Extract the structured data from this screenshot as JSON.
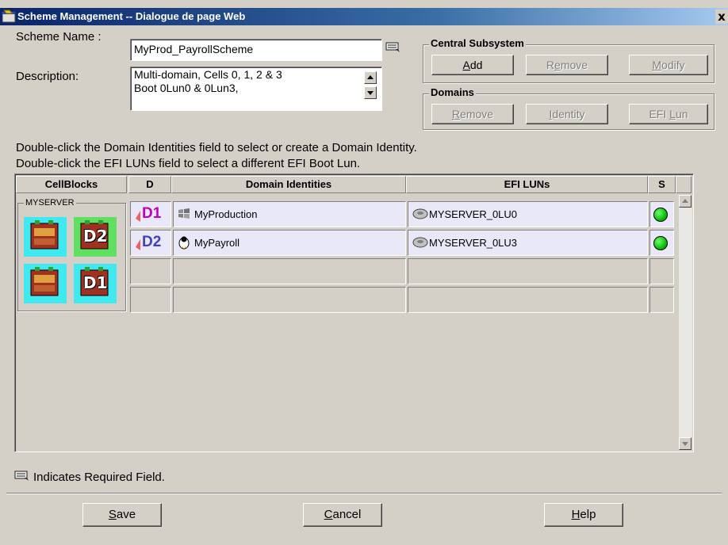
{
  "window": {
    "title": "Scheme Management -- Dialogue de page Web",
    "close": "x"
  },
  "form": {
    "scheme_name_label": "Scheme Name :",
    "scheme_name_value": "MyProd_PayrollScheme",
    "description_label": "Description:",
    "description_value": "Multi-domain, Cells 0, 1, 2 & 3\nBoot 0Lun0 & 0Lun3,"
  },
  "central_subsystem": {
    "title": "Central Subsystem",
    "add": "Add",
    "remove": "Remove",
    "modify": "Modify"
  },
  "domains": {
    "title": "Domains",
    "remove": "Remove",
    "identity": "Identity",
    "efi_lun": "EFI Lun"
  },
  "instructions": {
    "line1": "Double-click the Domain Identities field to select or create a Domain Identity.",
    "line2": "Double-click the EFI LUNs field to select a different EFI Boot Lun."
  },
  "table": {
    "headers": {
      "cellblocks": "CellBlocks",
      "d": "D",
      "identities": "Domain Identities",
      "efi": "EFI LUNs",
      "s": "S"
    },
    "server_name": "MYSERVER",
    "cellblock_labels": [
      "",
      "D2",
      "",
      "D1"
    ],
    "rows": [
      {
        "domain": "D1",
        "identity": "MyProduction",
        "identity_icon": "windows-icon",
        "efi_lun": "MYSERVER_0LU0",
        "status": "green"
      },
      {
        "domain": "D2",
        "identity": "MyPayroll",
        "identity_icon": "linux-penguin-icon",
        "efi_lun": "MYSERVER_0LU3",
        "status": "green"
      }
    ]
  },
  "footer": {
    "required_note": "Indicates Required Field.",
    "save": "Save",
    "cancel": "Cancel",
    "help": "Help"
  },
  "colors": {
    "title_bar": "#0a246a",
    "window_bg": "#d4d0c8",
    "row_bg": "#e8e8f8",
    "status_ok": "#00c000",
    "cellblock_bg": "#40e8f0"
  }
}
